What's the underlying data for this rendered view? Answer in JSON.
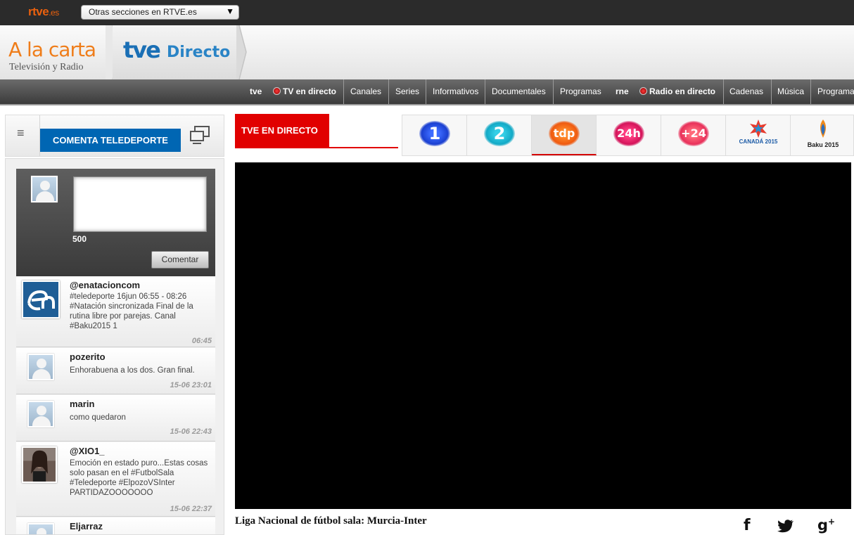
{
  "topbar": {
    "logo_main": "rtve",
    "logo_suffix": ".es",
    "sections_select": "Otras secciones en RTVE.es"
  },
  "header": {
    "alacarta_title": "A la carta",
    "alacarta_sub": "Televisión y Radio",
    "tve_logo": "tve",
    "directo_label": "Directo"
  },
  "nav": {
    "items": [
      "tve",
      "TV en directo",
      "Canales",
      "Series",
      "Informativos",
      "Documentales",
      "Programas",
      "rne",
      "Radio en directo",
      "Cadenas",
      "Música",
      "Programas"
    ]
  },
  "left": {
    "comenta_button": "COMENTA TELEDEPORTE",
    "char_count": "500",
    "submit_label": "Comentar",
    "comments": [
      {
        "user": "@enatacioncom",
        "text": "#teledeporte 16jun 06:55 - 08:26 #Natación sincronizada Final de la rutina libre por parejas. Canal #Baku2015 1",
        "time": "06:45",
        "avatar_icon": "enatacion-logo-icon"
      },
      {
        "user": "pozerito",
        "text": "Enhorabuena a los dos. Gran final.",
        "time": "15-06 23:01",
        "avatar_icon": "default-avatar-icon"
      },
      {
        "user": "marin",
        "text": "como quedaron",
        "time": "15-06 22:43",
        "avatar_icon": "default-avatar-icon"
      },
      {
        "user": "@XIO1_",
        "text": "Emoción en estado puro...Estas cosas solo pasan en el #FutbolSala #Teledeporte #ElpozoVSInter PARTIDAZOOOOOOO",
        "time": "15-06 22:37",
        "avatar_icon": "user-photo-icon"
      },
      {
        "user": "Eljarraz",
        "text": "",
        "time": "",
        "avatar_icon": "default-avatar-icon"
      }
    ]
  },
  "main": {
    "live_tab": "TVE EN DIRECTO",
    "channels": [
      {
        "label": "1",
        "icon": "la1-icon",
        "color": "#1a3fd0"
      },
      {
        "label": "2",
        "icon": "la2-icon",
        "color": "#12a9c6"
      },
      {
        "label": "tdp",
        "icon": "teledeporte-icon",
        "color": "#ef5a10"
      },
      {
        "label": "24h",
        "icon": "canal24h-icon",
        "color": "#d4145a"
      },
      {
        "label": "+24",
        "icon": "mas24-icon",
        "color": "#e8305a"
      },
      {
        "label": "CANADÁ 2015",
        "icon": "canada2015-icon",
        "color": "#1a5aa6"
      },
      {
        "label": "Baku 2015",
        "icon": "baku2015-icon",
        "color": "#222222"
      }
    ],
    "video_title": "Liga Nacional de fútbol sala: Murcia-Inter"
  },
  "colors": {
    "accent_red": "#e10000",
    "brand_blue": "#0066b3",
    "rtve_orange": "#e9600e"
  }
}
